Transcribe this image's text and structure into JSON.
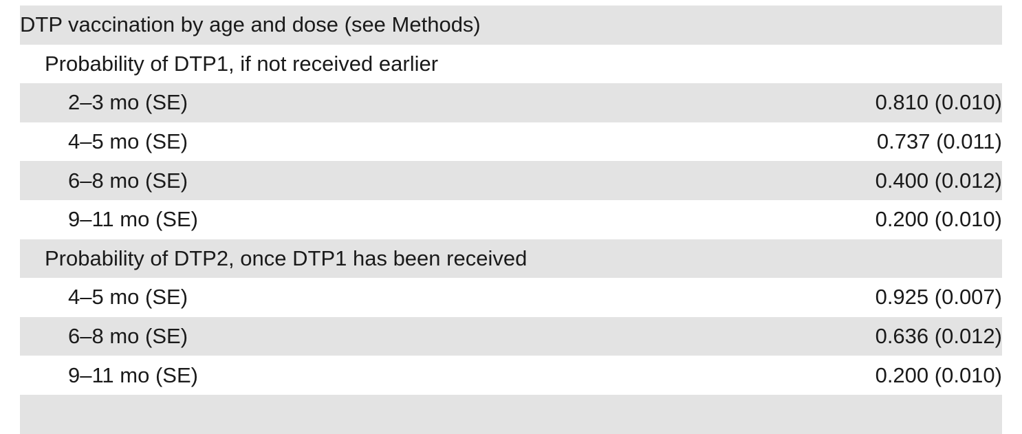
{
  "table": {
    "rows": [
      {
        "label": "DTP vaccination by age and dose (see Methods)",
        "value": ""
      },
      {
        "label": "Probability of DTP1, if not received earlier",
        "value": ""
      },
      {
        "label": "2–3 mo (SE)",
        "value": "0.810 (0.010)"
      },
      {
        "label": "4–5 mo (SE)",
        "value": "0.737 (0.011)"
      },
      {
        "label": "6–8 mo (SE)",
        "value": "0.400 (0.012)"
      },
      {
        "label": "9–11 mo (SE)",
        "value": "0.200 (0.010)"
      },
      {
        "label": "Probability of DTP2, once DTP1 has been received",
        "value": ""
      },
      {
        "label": "4–5 mo (SE)",
        "value": "0.925 (0.007)"
      },
      {
        "label": "6–8 mo (SE)",
        "value": "0.636 (0.012)"
      },
      {
        "label": "9–11 mo (SE)",
        "value": "0.200 (0.010)"
      },
      {
        "label": "",
        "value": ""
      }
    ]
  }
}
